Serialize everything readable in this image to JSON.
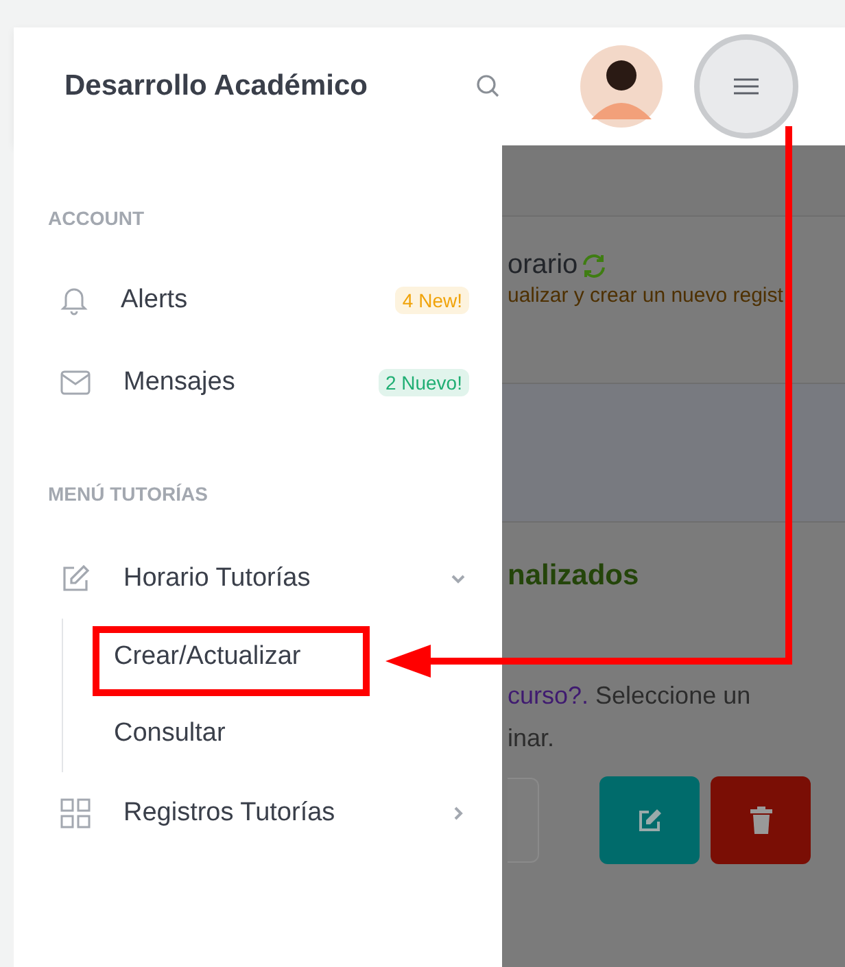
{
  "header": {
    "title": "Desarrollo Académico"
  },
  "sidebar": {
    "sections": [
      {
        "heading": "ACCOUNT",
        "items": [
          {
            "kind": "bell",
            "label": "Alerts",
            "badge": {
              "text": "4 New!",
              "color": "#f0a30a"
            }
          },
          {
            "kind": "mail",
            "label": "Mensajes",
            "badge": {
              "text": "2 Nuevo!",
              "color": "#1fae73"
            }
          }
        ]
      },
      {
        "heading": "MENÚ TUTORÍAS",
        "items": [
          {
            "kind": "edit",
            "label": "Horario Tutorías",
            "expanded": true,
            "children": [
              {
                "label": "Crear/Actualizar"
              },
              {
                "label": "Consultar"
              }
            ]
          },
          {
            "kind": "grid",
            "label": "Registros Tutorías",
            "expanded": false
          }
        ]
      }
    ]
  },
  "main": {
    "title": "orario",
    "subtitle": "ualizar y crear un nuevo regist",
    "card_title": "nalizados",
    "question_link": "curso?.",
    "question_text": " Seleccione un inar."
  }
}
